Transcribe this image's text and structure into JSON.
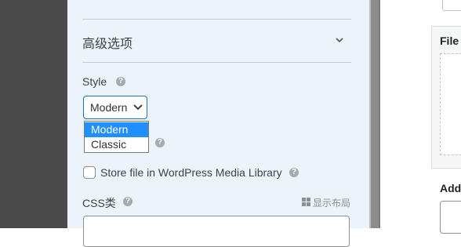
{
  "advanced": {
    "title": "高级选项"
  },
  "style": {
    "label": "Style",
    "selected": "Modern",
    "options": [
      "Modern",
      "Classic"
    ]
  },
  "media_library": {
    "label": "Store file in WordPress Media Library",
    "checked": false
  },
  "css_class": {
    "label": "CSS类",
    "layout_link": "显示布局"
  },
  "right_panel": {
    "file_label": "File",
    "add_label": "Add"
  },
  "icons": {
    "help": "question-circle-icon",
    "chevron": "chevron-down-icon",
    "grid": "grid-icon"
  },
  "colors": {
    "accent": "#2271b1",
    "selected_option": "#1e90ff",
    "panel_bg": "#ebf3fb"
  },
  "help_glyph": "?"
}
